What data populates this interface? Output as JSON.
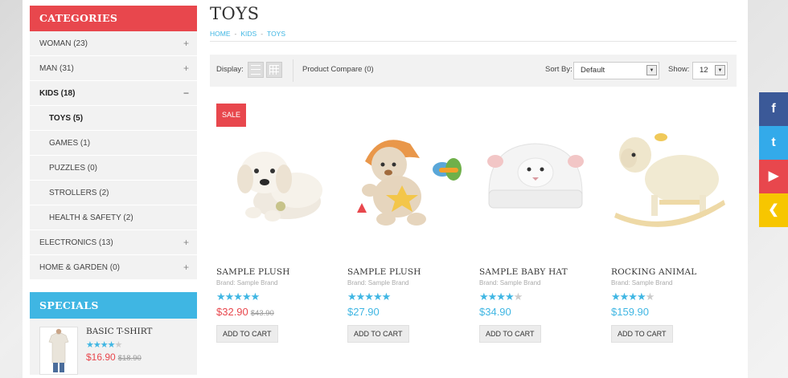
{
  "sidebar": {
    "categories_title": "CATEGORIES",
    "categories": [
      {
        "label": "WOMAN (23)",
        "toggle": "+"
      },
      {
        "label": "MAN (31)",
        "toggle": "+"
      },
      {
        "label": "KIDS (18)",
        "toggle": "−"
      },
      {
        "label": "TOYS (5)",
        "toggle": ""
      },
      {
        "label": "GAMES (1)",
        "toggle": ""
      },
      {
        "label": "PUZZLES (0)",
        "toggle": ""
      },
      {
        "label": "STROLLERS (2)",
        "toggle": ""
      },
      {
        "label": "HEALTH & SAFETY (2)",
        "toggle": ""
      },
      {
        "label": "ELECTRONICS (13)",
        "toggle": "+"
      },
      {
        "label": "HOME & GARDEN (0)",
        "toggle": "+"
      }
    ],
    "specials_title": "SPECIALS",
    "special": {
      "name": "BASIC T-SHIRT",
      "rating": 4,
      "price": "$16.90",
      "old_price": "$18.90"
    }
  },
  "page": {
    "title": "TOYS",
    "breadcrumb": [
      "HOME",
      "KIDS",
      "TOYS"
    ]
  },
  "toolbar": {
    "display_label": "Display:",
    "compare_label": "Product Compare (0)",
    "sort_label": "Sort By:",
    "sort_value": "Default",
    "show_label": "Show:",
    "show_value": "12"
  },
  "sale_badge": "SALE",
  "products": [
    {
      "name": "SAMPLE PLUSH",
      "brand": "Brand: Sample Brand",
      "rating": 5,
      "price": "$32.90",
      "old_price": "$43.90",
      "cart": "ADD TO CART",
      "icon": "puppy-image"
    },
    {
      "name": "SAMPLE PLUSH",
      "brand": "Brand: Sample Brand",
      "rating": 5,
      "price": "$27.90",
      "old_price": "",
      "cart": "ADD TO CART",
      "icon": "teddy-image"
    },
    {
      "name": "SAMPLE BABY HAT",
      "brand": "Brand: Sample Brand",
      "rating": 4,
      "price": "$34.90",
      "old_price": "",
      "cart": "ADD TO CART",
      "icon": "lamb-hat-image"
    },
    {
      "name": "ROCKING ANIMAL",
      "brand": "Brand: Sample Brand",
      "rating": 4,
      "price": "$159.90",
      "old_price": "",
      "cart": "ADD TO CART",
      "icon": "rocking-sheep-image"
    }
  ],
  "social": [
    {
      "icon": "facebook-icon",
      "glyph": "f"
    },
    {
      "icon": "twitter-icon",
      "glyph": "t"
    },
    {
      "icon": "youtube-icon",
      "glyph": "▶"
    },
    {
      "icon": "collapse-arrow-icon",
      "glyph": "❮"
    }
  ],
  "colors": {
    "accent_red": "#e8474d",
    "accent_blue": "#3fb6e3",
    "facebook": "#3b5998",
    "twitter": "#33aaea",
    "social_yellow": "#f7c600"
  }
}
